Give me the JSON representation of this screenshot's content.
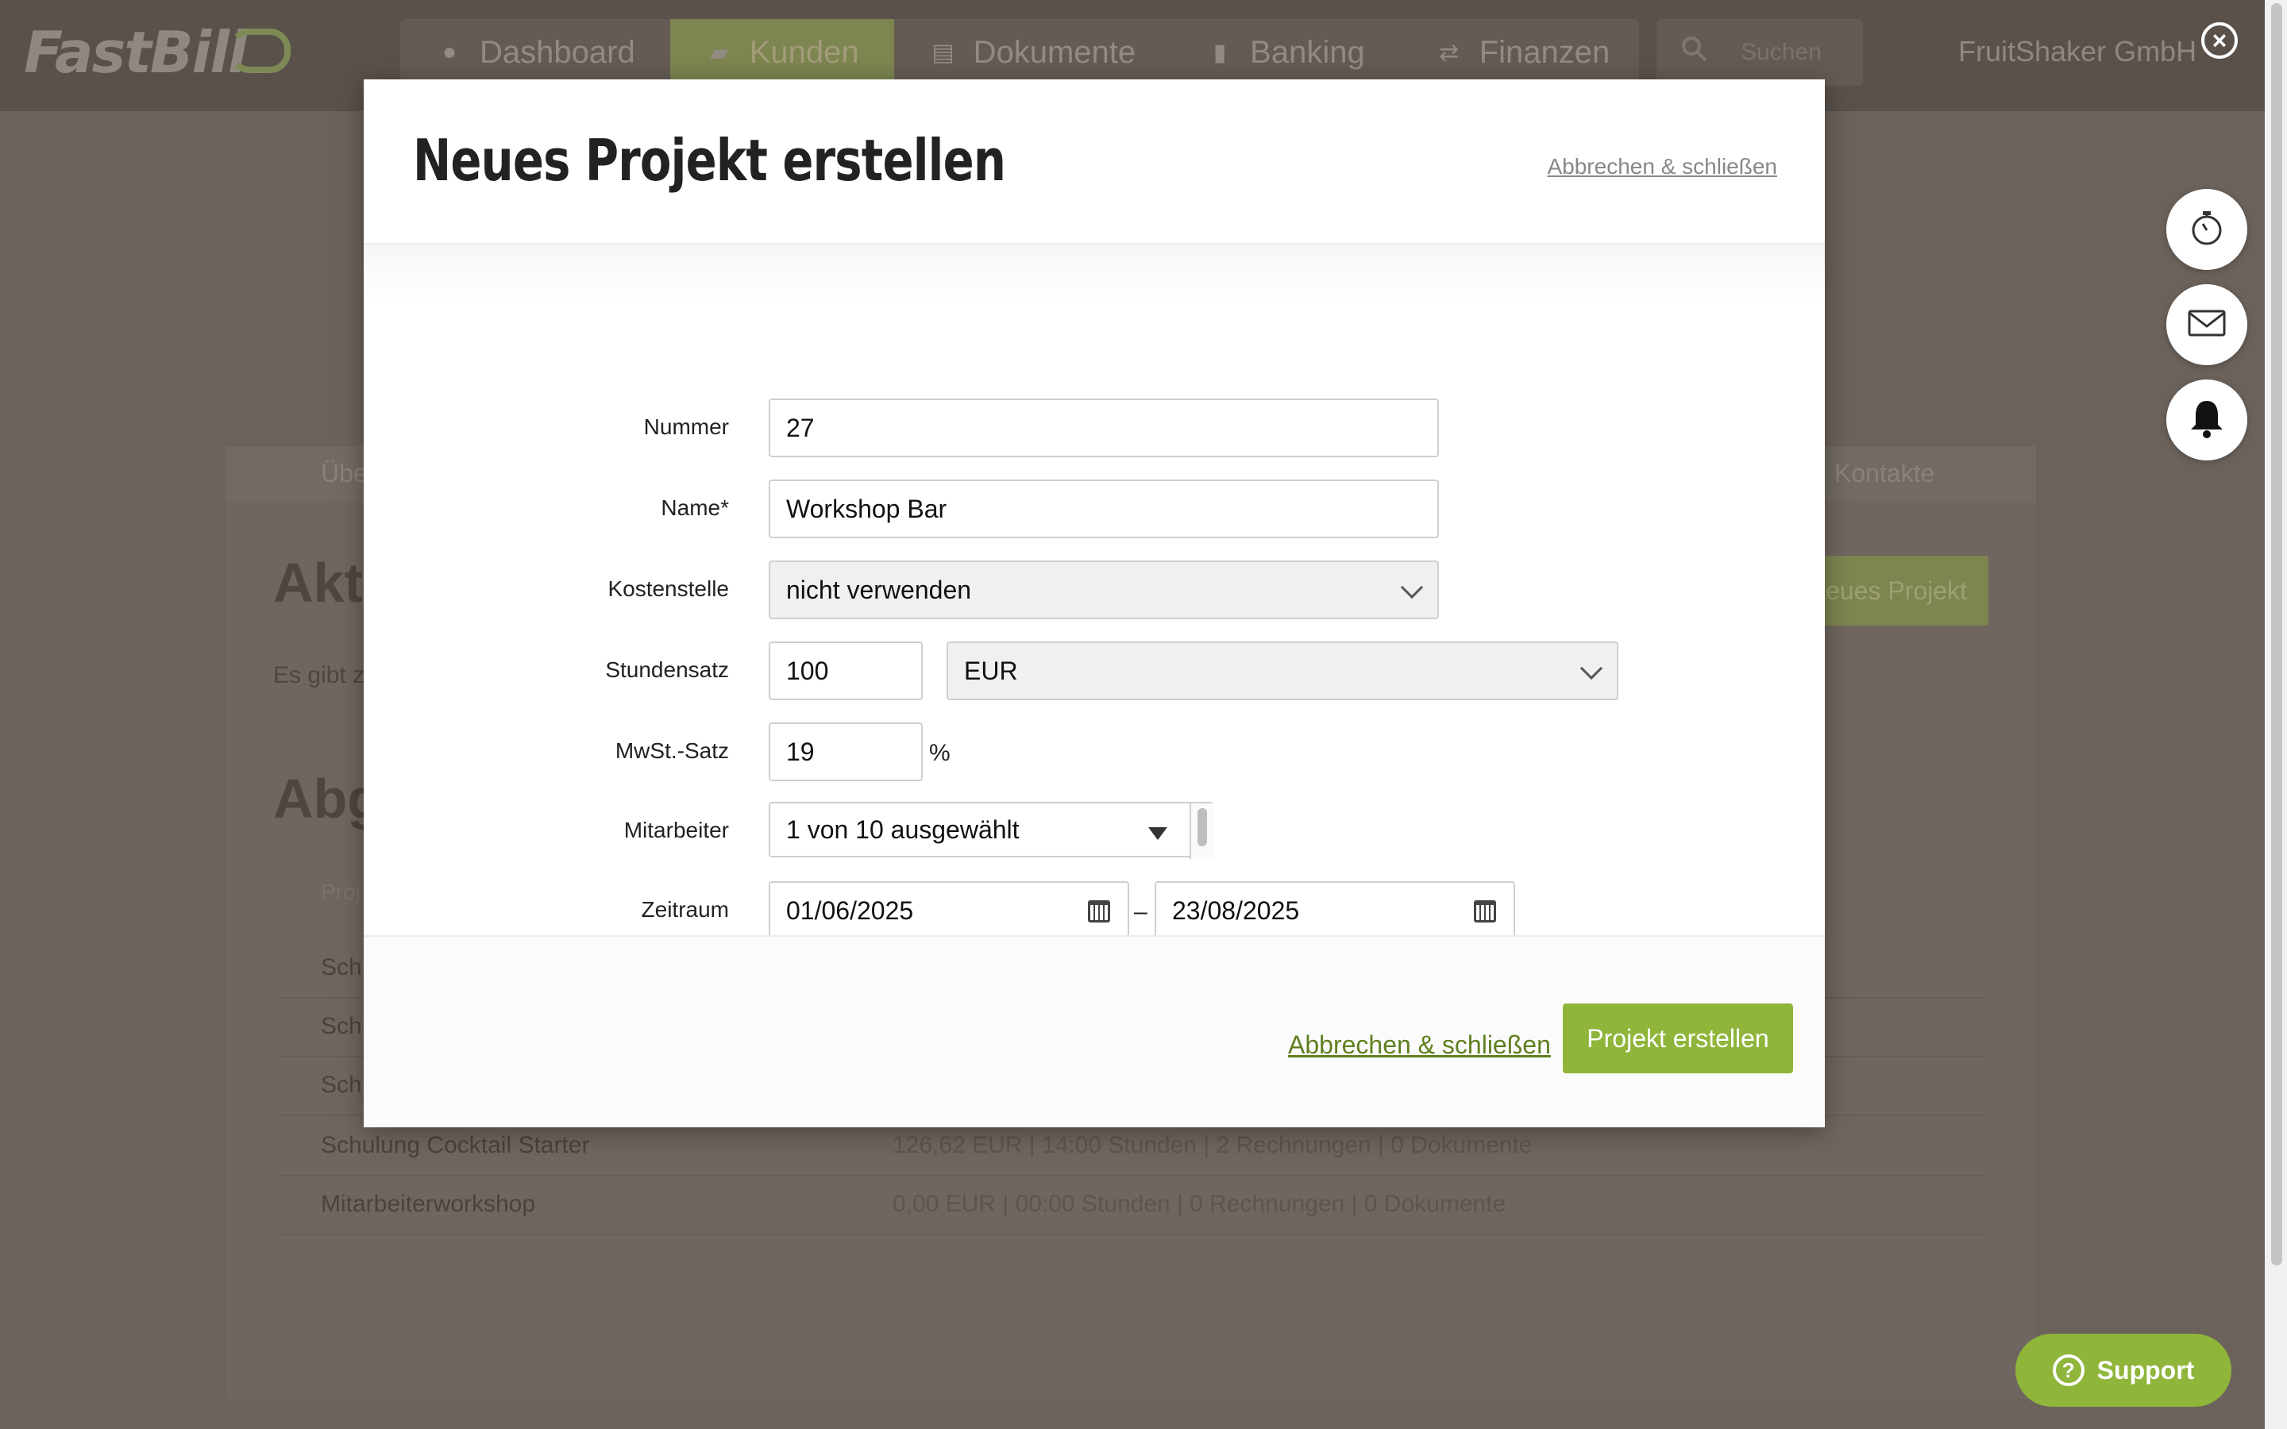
{
  "app": {
    "logo": "FastBill",
    "nav": [
      {
        "label": "Dashboard",
        "icon": "info-circle-icon",
        "active": false
      },
      {
        "label": "Kunden",
        "icon": "briefcase-icon",
        "active": true
      },
      {
        "label": "Dokumente",
        "icon": "document-icon",
        "active": false
      },
      {
        "label": "Banking",
        "icon": "bar-chart-icon",
        "active": false
      },
      {
        "label": "Finanzen",
        "icon": "transfer-arrows-icon",
        "active": false
      }
    ],
    "search_placeholder": "Suchen",
    "company": "FruitShaker GmbH"
  },
  "background": {
    "tab_left": "Übe",
    "tab_right": "Kontakte",
    "heading_current": "Aktu",
    "text_current": "Es gibt z",
    "heading_closed": "Abge",
    "column_project": "Proj",
    "new_project_button": "eues Projekt",
    "rows": [
      {
        "name": "Sch",
        "summary": ""
      },
      {
        "name": "Sch",
        "summary": ""
      },
      {
        "name": "Sch",
        "summary": ""
      },
      {
        "name": "Schulung Cocktail Starter",
        "summary": "126,62 EUR | 14:00 Stunden | 2 Rechnungen | 0 Dokumente"
      },
      {
        "name": "Mitarbeiterworkshop",
        "summary": "0,00 EUR | 00:00 Stunden | 0 Rechnungen | 0 Dokumente"
      }
    ]
  },
  "side_buttons": [
    "stopwatch-icon",
    "mail-icon",
    "bell-icon"
  ],
  "support": {
    "label": "Support"
  },
  "modal": {
    "title": "Neues Projekt erstellen",
    "header_cancel": "Abbrechen & schließen",
    "fields": {
      "nummer": {
        "label": "Nummer",
        "value": "27"
      },
      "name": {
        "label": "Name*",
        "value": "Workshop Bar"
      },
      "kostenstelle": {
        "label": "Kostenstelle",
        "value": "nicht verwenden"
      },
      "stundensatz": {
        "label": "Stundensatz",
        "value": "100",
        "currency": "EUR"
      },
      "mwst": {
        "label": "MwSt.-Satz",
        "value": "19",
        "unit": "%"
      },
      "mitarbeiter": {
        "label": "Mitarbeiter",
        "value": "1 von 10 ausgewählt"
      },
      "zeitraum": {
        "label": "Zeitraum",
        "from": "01/06/2025",
        "separator": "–",
        "to": "23/08/2025"
      }
    },
    "footer_cancel": "Abbrechen & schließen",
    "submit": "Projekt erstellen"
  },
  "colors": {
    "accent": "#8fb53a",
    "link": "#5f7f1f",
    "overlay": "#6b625b"
  }
}
